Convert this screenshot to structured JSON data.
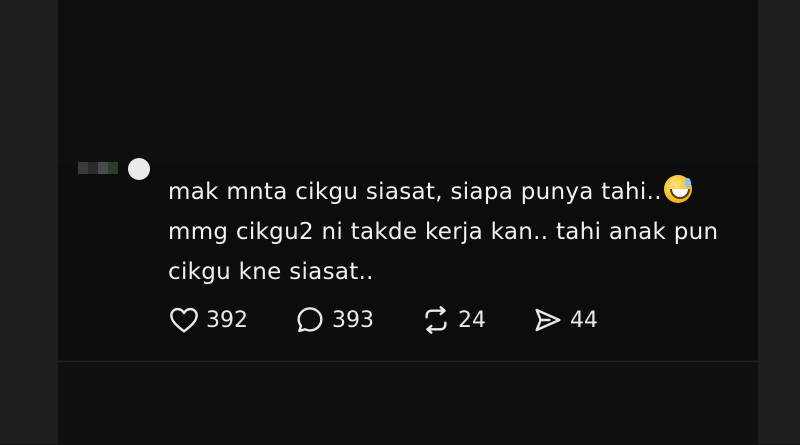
{
  "post": {
    "comment_line1": "mak mnta cikgu siasat, siapa punya tahi..",
    "comment_line2": "mmg cikgu2 ni takde kerja kan.. tahi anak pun",
    "comment_line3": "cikgu kne siasat..",
    "emoji": "grinning-sweat-emoji"
  },
  "actions": {
    "likes": "392",
    "comments": "393",
    "reposts": "24",
    "shares": "44"
  },
  "icons": {
    "like": "heart-icon",
    "comment": "comment-bubble-icon",
    "repost": "repost-icon",
    "share": "send-icon"
  }
}
